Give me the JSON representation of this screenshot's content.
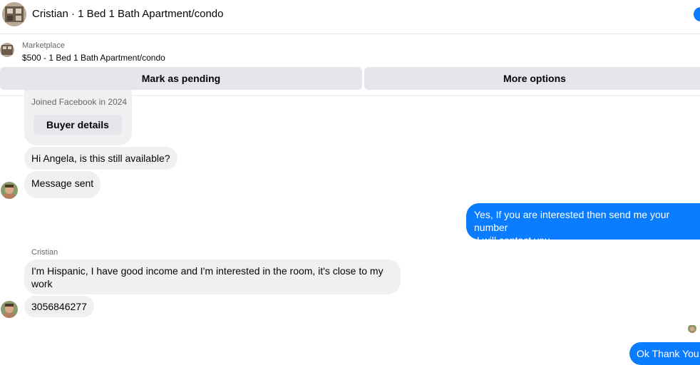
{
  "header": {
    "title": "Cristian · 1 Bed 1 Bath Apartment/condo"
  },
  "listing": {
    "kind": "Marketplace",
    "price_title": "$500 - 1 Bed 1 Bath Apartment/condo"
  },
  "actions": {
    "pending_label": "Mark as pending",
    "more_label": "More options"
  },
  "buyer_card": {
    "joined": "Joined Facebook in 2024",
    "button_label": "Buyer details"
  },
  "messages": [
    {
      "from": "buyer",
      "text": "Hi Angela, is this still available?"
    },
    {
      "from": "buyer",
      "text": "Message sent"
    },
    {
      "from": "seller",
      "lines": [
        "Yes, If you are interested then send me your number",
        " I will contact you."
      ]
    },
    {
      "from": "buyer",
      "sender_label": "Cristian",
      "text": "I'm Hispanic, I have good income and I'm interested in the room, it's close to my work"
    },
    {
      "from": "buyer",
      "text": "3056846277"
    },
    {
      "from": "seller",
      "text": "Ok Thank You"
    }
  ],
  "colors": {
    "outgoing_bubble": "#0a7cff",
    "incoming_bubble": "#f0f0f0",
    "button_bg": "#e4e6eb"
  }
}
